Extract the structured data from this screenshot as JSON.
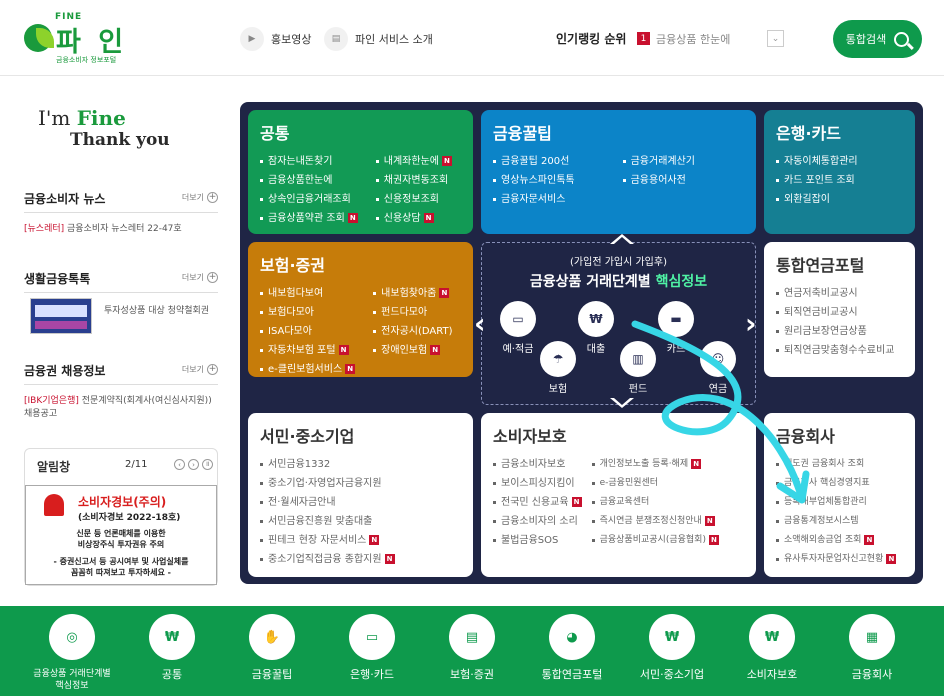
{
  "header": {
    "logo_top": "FINE",
    "logo_main": "파 인",
    "logo_sub": "금융소비자 정보포털",
    "links": [
      {
        "label": "홍보영상",
        "icon": "video-icon"
      },
      {
        "label": "파인 서비스 소개",
        "icon": "document-icon"
      }
    ],
    "ranking_title": "인기랭킹 순위",
    "ranking_num": "1",
    "ranking_item": "금융상품 한눈에",
    "search_label": "통합검색"
  },
  "left": {
    "slogan1_a": "I'm ",
    "slogan1_b": "Fine",
    "slogan2": "Thank you",
    "more": "더보기",
    "news": {
      "title": "금융소비자 뉴스",
      "tag": "[뉴스레터]",
      "text": " 금융소비자 뉴스레터 22-47호"
    },
    "life": {
      "title": "생활금융톡톡",
      "text": "투자성상품 대상 청약철회권"
    },
    "jobs": {
      "title": "금융권 채용정보",
      "tag": "[IBK기업은행]",
      "text": " 전문계약직(회계사(여신심사지원)) 채용공고"
    },
    "alarm": {
      "title": "알림창",
      "page": "2/11",
      "h1": "소비자경보(주의)",
      "h2": "(소비자경보 2022-18호)",
      "b1": "신문 등 언론매체를 이용한\n비상장주식 투자권유 주의",
      "b2": "- 증권신고서 등 공시여부 및 사업실체를\n꼼꼼히 따져보고 투자하세요 -"
    }
  },
  "cards": {
    "gongtong": {
      "title": "공통",
      "col1": [
        "잠자는내돈찾기",
        "금융상품한눈에",
        "상속인금융거래조회",
        "금융상품약관 조회"
      ],
      "col2": [
        "내계좌한눈에",
        "채권자변동조회",
        "신용정보조회",
        "신용상담"
      ]
    },
    "ggultip": {
      "title": "금융꿀팁",
      "col1": [
        "금융꿀팁 200선",
        "영상뉴스파인톡톡",
        "금융자문서비스"
      ],
      "col2": [
        "금융거래계산기",
        "금융용어사전"
      ]
    },
    "bank": {
      "title": "은행·카드",
      "col1": [
        "자동이체통합관리",
        "카드 포인트 조회",
        "외환길잡이"
      ]
    },
    "insure": {
      "title": "보험·증권",
      "col1": [
        "내보험다보여",
        "보험다모아",
        "ISA다모아",
        "자동차보험 포털",
        "e-클린보험서비스"
      ],
      "col2": [
        "내보험찾아줌",
        "펀드다모아",
        "전자공시(DART)",
        "장애인보험"
      ]
    },
    "pension": {
      "title": "통합연금포털",
      "col1": [
        "연금저축비교공시",
        "퇴직연금비교공시",
        "원리금보장연금상품",
        "퇴직연금맞춤형수수료비교"
      ]
    },
    "smb": {
      "title": "서민·중소기업",
      "col1": [
        "서민금융1332",
        "중소기업·자영업자금융지원",
        "전·월세자금안내",
        "서민금융진흥원 맞춤대출",
        "핀테크 현장 자문서비스",
        "중소기업직접금융 종합지원"
      ]
    },
    "consumer": {
      "title": "소비자보호",
      "col1": [
        "금융소비자보호",
        "보이스피싱지킴이",
        "전국민 신용교육",
        "금융소비자의 소리",
        "불법금융SOS"
      ],
      "col2": [
        "개인정보노출 등록·해제",
        "e-금융민원센터",
        "금융교육센터",
        "즉시연금 분쟁조정신청안내",
        "금융상품비교공시(금융협회)"
      ]
    },
    "company": {
      "title": "금융회사",
      "col1": [
        "제도권 금융회사 조회",
        "금융회사 핵심경영지표",
        "등록대부업체통합관리",
        "금융통계정보시스템",
        "소액해외송금업 조회",
        "유사투자자문업자신고현황"
      ]
    },
    "new_badge": "N"
  },
  "core": {
    "sub": "(가입전 가입시 가입후)",
    "main_a": "금융상품 거래단계별 ",
    "main_b": "핵심정보",
    "icons": [
      {
        "label": "예·적금",
        "icon": "bankbook-icon"
      },
      {
        "label": "대출",
        "icon": "loan-hand-icon"
      },
      {
        "label": "카드",
        "icon": "card-icon"
      },
      {
        "label": "보험",
        "icon": "umbrella-icon"
      },
      {
        "label": "펀드",
        "icon": "fund-chart-icon"
      },
      {
        "label": "연금",
        "icon": "pension-people-icon"
      }
    ]
  },
  "footer": {
    "items": [
      {
        "label": "금융상품 거래단계별\n핵심정보",
        "icon": "core-info-icon"
      },
      {
        "label": "공통",
        "icon": "money-bag-icon"
      },
      {
        "label": "금융꿀팁",
        "icon": "tip-hand-icon"
      },
      {
        "label": "은행·카드",
        "icon": "bank-card-icon"
      },
      {
        "label": "보험·증권",
        "icon": "insurance-doc-icon"
      },
      {
        "label": "통합연금포털",
        "icon": "piggy-bank-icon"
      },
      {
        "label": "서민·중소기업",
        "icon": "won-cycle-icon"
      },
      {
        "label": "소비자보호",
        "icon": "consumer-coin-icon"
      },
      {
        "label": "금융회사",
        "icon": "building-icon"
      }
    ]
  },
  "colors": {
    "brand_green": "#0e9a4c",
    "panel_navy": "#1f2545",
    "card_green": "#129a55",
    "card_blue": "#0c84c8",
    "card_teal": "#157f93",
    "card_gold": "#c67c0a",
    "badge_red": "#c8102e",
    "highlight_mint": "#4ff2a5"
  }
}
